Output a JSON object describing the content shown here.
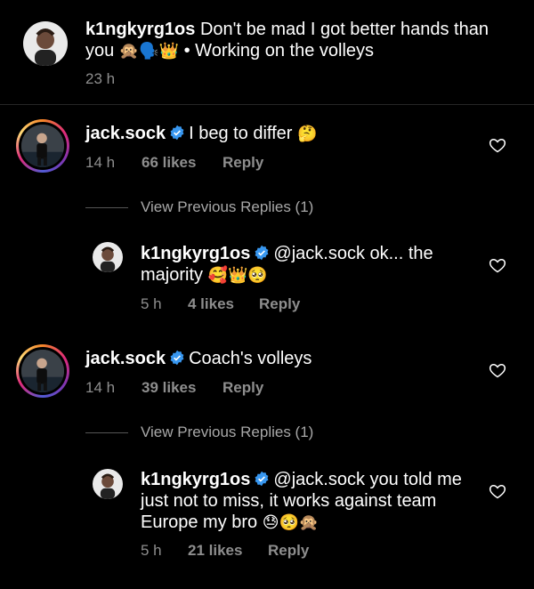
{
  "caption": {
    "username": "k1ngkyrg1os",
    "text_line1": " Don't be mad I got better hands than",
    "text_line2_start": "you ",
    "emoji": "🙊🗣️👑",
    "text_line2_end": " • Working on the volleys",
    "time": "23 h"
  },
  "comments": [
    {
      "username": "jack.sock",
      "text": "I beg to differ",
      "emoji": "🤔",
      "time": "14 h",
      "likes": "66 likes",
      "reply_label": "Reply",
      "view_replies": "View Previous Replies (1)",
      "reply": {
        "username": "k1ngkyrg1os",
        "text_line1": "@jack.sock ok... the",
        "text_line2": "majority ",
        "emoji": "🥰👑🥺",
        "time": "5 h",
        "likes": "4 likes",
        "reply_label": "Reply"
      }
    },
    {
      "username": "jack.sock",
      "text": "Coach's volleys",
      "time": "14 h",
      "likes": "39 likes",
      "reply_label": "Reply",
      "view_replies": "View Previous Replies (1)",
      "reply": {
        "username": "k1ngkyrg1os",
        "text_line1": "@jack.sock you told me",
        "text_line2": "just not to miss, it works against team",
        "text_line3": "Europe my bro ",
        "emoji": "😓🥺🙊",
        "time": "5 h",
        "likes": "21 likes",
        "reply_label": "Reply"
      }
    }
  ],
  "colors": {
    "verified": "#3897f0",
    "meta": "#8e8e8e",
    "background": "#000000"
  }
}
